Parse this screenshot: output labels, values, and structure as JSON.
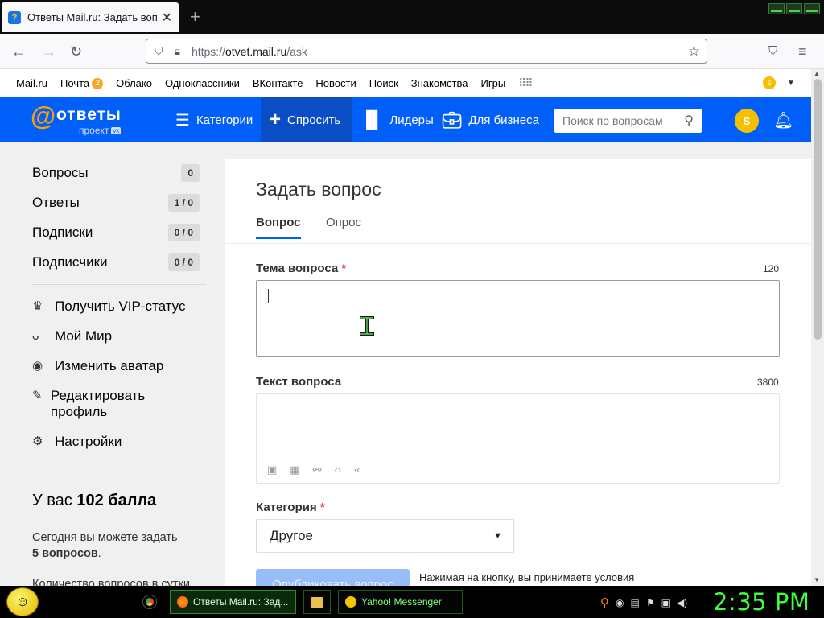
{
  "browser": {
    "tab_title": "Ответы Mail.ru: Задать вопрос",
    "tab_close": "✕",
    "new_tab": "+",
    "url_prefix": "https://",
    "url_host": "otvet.mail.ru",
    "url_path": "/ask"
  },
  "bookmarks": {
    "items": [
      "Mail.ru",
      "Почта",
      "Облако",
      "Одноклассники",
      "ВКонтакте",
      "Новости",
      "Поиск",
      "Знакомства",
      "Игры"
    ],
    "mail_badge": "2",
    "avatar_letter": "S"
  },
  "site": {
    "logo_word": "ответы",
    "logo_sub": "проект",
    "logo_vk": "vk",
    "nav": {
      "categories": "Категории",
      "ask": "Спросить",
      "leaders": "Лидеры",
      "business": "Для бизнеса"
    },
    "search_placeholder": "Поиск по вопросам",
    "avatar_letter": "S"
  },
  "sidebar": {
    "stats": [
      {
        "label": "Вопросы",
        "count": "0"
      },
      {
        "label": "Ответы",
        "count": "1 / 0"
      },
      {
        "label": "Подписки",
        "count": "0 / 0"
      },
      {
        "label": "Подписчики",
        "count": "0 / 0"
      }
    ],
    "menu": [
      {
        "label": "Получить VIP-статус",
        "icon": "crown-icon"
      },
      {
        "label": "Мой Мир",
        "icon": "people-icon"
      },
      {
        "label": "Изменить аватар",
        "icon": "camera-icon"
      },
      {
        "label": "Редактировать профиль",
        "icon": "edit-user-icon"
      },
      {
        "label": "Настройки",
        "icon": "gear-icon"
      }
    ],
    "points_prefix": "У вас",
    "points_value": "102 балла",
    "today_text": "Сегодня вы можете задать",
    "today_value": "5 вопросов",
    "today_suffix": ".",
    "per_day": "Количество вопросов в сутки"
  },
  "form": {
    "page_title": "Задать вопрос",
    "tabs": [
      "Вопрос",
      "Опрос"
    ],
    "topic_label": "Тема вопроса",
    "topic_max": "120",
    "topic_value": "",
    "text_label": "Текст вопроса",
    "text_max": "3800",
    "text_value": "",
    "category_label": "Категория",
    "category_value": "Другое",
    "required_mark": "*",
    "publish_button": "Опубликовать вопрос",
    "terms": "Нажимая на кнопку, вы принимаете условия"
  },
  "taskbar": {
    "ff_task": "Ответы Mail.ru: Зад...",
    "yahoo_task": "Yahoo! Messenger",
    "clock": "2:35 PM"
  },
  "colors": {
    "header_blue": "#005ff9",
    "logo_orange": "#ff9e00",
    "avatar_yellow": "#f5c000",
    "clock_green": "#3cff3c"
  }
}
